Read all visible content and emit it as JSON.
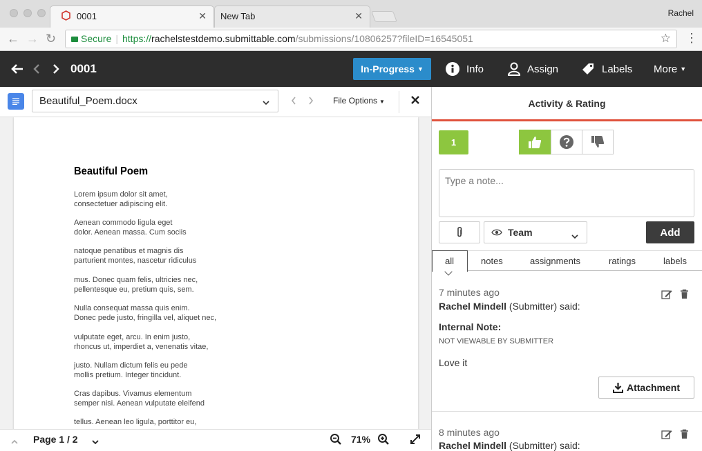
{
  "browser": {
    "tabs": [
      {
        "label": "0001"
      },
      {
        "label": "New Tab"
      }
    ],
    "user": "Rachel",
    "secure_label": "Secure",
    "url_scheme": "https://",
    "url_host": "rachelstestdemo.submittable.com",
    "url_path": "/submissions/10806257?fileID=16545051"
  },
  "header": {
    "submission_id": "0001",
    "status": "In-Progress",
    "info": "Info",
    "assign": "Assign",
    "labels": "Labels",
    "more": "More"
  },
  "viewer": {
    "file_name": "Beautiful_Poem.docx",
    "file_options": "File Options",
    "page_label": "Page 1 / 2",
    "zoom": "71%",
    "doc_title": "Beautiful Poem",
    "stanzas": [
      "Lorem ipsum dolor sit amet,\nconsectetuer adipiscing elit.",
      "Aenean commodo ligula eget\ndolor. Aenean massa. Cum sociis",
      "natoque penatibus et magnis dis\nparturient montes, nascetur ridiculus",
      "mus. Donec quam felis, ultricies nec,\npellentesque eu, pretium quis, sem.",
      "Nulla consequat massa quis enim.\nDonec pede justo, fringilla vel, aliquet nec,",
      "vulputate eget, arcu. In enim justo,\nrhoncus ut, imperdiet a, venenatis vitae,",
      "justo. Nullam dictum felis eu pede\nmollis pretium. Integer tincidunt.",
      "Cras dapibus. Vivamus elementum\nsemper nisi. Aenean vulputate eleifend",
      "tellus. Aenean leo ligula, porttitor eu,"
    ]
  },
  "panel": {
    "title": "Activity & Rating",
    "rating_count": "1",
    "note_placeholder": "Type a note...",
    "visibility": "Team",
    "add": "Add",
    "filters": [
      "all",
      "notes",
      "assignments",
      "ratings",
      "labels"
    ],
    "activities": [
      {
        "time": "7 minutes ago",
        "author": "Rachel Mindell",
        "role": " (Submitter) said:",
        "heading": "Internal Note:",
        "subheading": "NOT VIEWABLE BY SUBMITTER",
        "body": "Love it",
        "attachment": "Attachment"
      },
      {
        "time": "8 minutes ago",
        "author": "Rachel Mindell",
        "role": " (Submitter) said:"
      }
    ]
  },
  "colors": {
    "status_blue": "#2b8ccb",
    "accent_red": "#e0523c",
    "rating_green": "#8dc63f",
    "header_dark": "#2d2d2d"
  }
}
